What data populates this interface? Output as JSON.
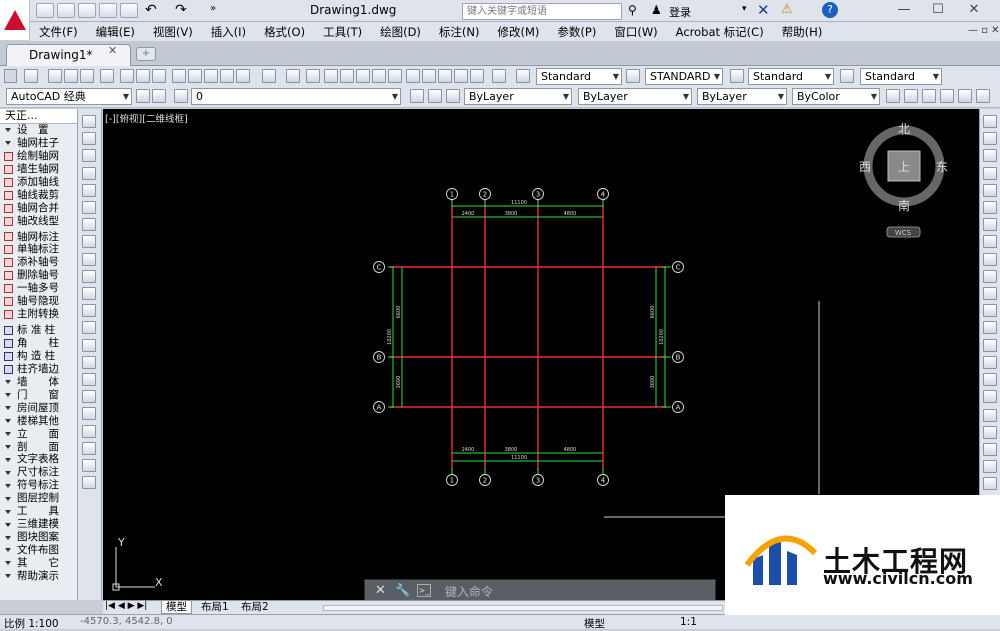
{
  "titlebar": {
    "document_title": "Drawing1.dwg",
    "search_placeholder": "键入关键字或短语",
    "login_label": "登录"
  },
  "menus": [
    "文件(F)",
    "编辑(E)",
    "视图(V)",
    "插入(I)",
    "格式(O)",
    "工具(T)",
    "绘图(D)",
    "标注(N)",
    "修改(M)",
    "参数(P)",
    "窗口(W)",
    "Acrobat 标记(C)",
    "帮助(H)"
  ],
  "doc_tab": {
    "label": "Drawing1*"
  },
  "styles_toolbar": {
    "text_style": "Standard",
    "dim_style": "STANDARD",
    "table_style": "Standard",
    "mleader_style": "Standard"
  },
  "workspace_toolbar": {
    "workspace": "AutoCAD 经典",
    "layer": "0",
    "color": "ByLayer",
    "linetype": "ByLayer",
    "lineweight": "ByLayer",
    "plotstyle": "ByColor"
  },
  "left_panel": {
    "title": "天正...",
    "items": [
      {
        "label": "设　置",
        "type": "group"
      },
      {
        "label": "轴网柱子",
        "type": "group"
      },
      {
        "label": "绘制轴网",
        "type": "cmd"
      },
      {
        "label": "墙生轴网",
        "type": "cmd"
      },
      {
        "label": "添加轴线",
        "type": "cmd"
      },
      {
        "label": "轴线裁剪",
        "type": "cmd"
      },
      {
        "label": "轴网合并",
        "type": "cmd"
      },
      {
        "label": "轴改线型",
        "type": "cmd"
      },
      {
        "label": "",
        "type": "sep"
      },
      {
        "label": "轴网标注",
        "type": "cmd"
      },
      {
        "label": "单轴标注",
        "type": "cmd"
      },
      {
        "label": "添补轴号",
        "type": "cmd"
      },
      {
        "label": "删除轴号",
        "type": "cmd"
      },
      {
        "label": "一轴多号",
        "type": "cmd"
      },
      {
        "label": "轴号隐现",
        "type": "cmd"
      },
      {
        "label": "主附转换",
        "type": "cmd"
      },
      {
        "label": "",
        "type": "sep"
      },
      {
        "label": "标 准 柱",
        "type": "cmd2"
      },
      {
        "label": "角　　柱",
        "type": "cmd2"
      },
      {
        "label": "构 造 柱",
        "type": "cmd2"
      },
      {
        "label": "柱齐墙边",
        "type": "cmd2"
      },
      {
        "label": "墙　　体",
        "type": "group"
      },
      {
        "label": "门　　窗",
        "type": "group"
      },
      {
        "label": "房间屋顶",
        "type": "group"
      },
      {
        "label": "楼梯其他",
        "type": "group"
      },
      {
        "label": "立　　面",
        "type": "group"
      },
      {
        "label": "剖　　面",
        "type": "group"
      },
      {
        "label": "文字表格",
        "type": "group"
      },
      {
        "label": "尺寸标注",
        "type": "group"
      },
      {
        "label": "符号标注",
        "type": "group"
      },
      {
        "label": "图层控制",
        "type": "group"
      },
      {
        "label": "工　　具",
        "type": "group"
      },
      {
        "label": "三维建模",
        "type": "group"
      },
      {
        "label": "图块图案",
        "type": "group"
      },
      {
        "label": "文件布图",
        "type": "group"
      },
      {
        "label": "其　　它",
        "type": "group"
      },
      {
        "label": "帮助演示",
        "type": "group"
      }
    ]
  },
  "canvas": {
    "viewport_label": "[-][俯视][二维线框]",
    "axis_bubbles_top": [
      "1",
      "2",
      "3",
      "4"
    ],
    "axis_bubbles_side": [
      "C",
      "B",
      "A"
    ],
    "dims_top": [
      "2400",
      "3800",
      "4800"
    ],
    "total_top": "11100",
    "dims_side": [
      "6600",
      "3600"
    ],
    "total_side": "10200",
    "ucs_x": "X",
    "ucs_y": "Y"
  },
  "viewcube": {
    "north": "北",
    "south": "南",
    "east": "东",
    "west": "西",
    "face": "上",
    "wcs": "WCS"
  },
  "command_line": {
    "placeholder": "键入命令"
  },
  "layout_tabs": [
    "模型",
    "布局1",
    "布局2"
  ],
  "status": {
    "scale": "比例 1:100",
    "coords": "-4570.3,  4542.8,  0",
    "model": "模型",
    "annoscale": "1:1"
  },
  "watermark": {
    "brand": "土木工程网",
    "url": "www.civilcn.com"
  },
  "colors": {
    "axis_line": "#e8303a",
    "dim_line": "#3adb3a",
    "bubble": "#e0e0e0",
    "canvas_bg": "#000000"
  }
}
